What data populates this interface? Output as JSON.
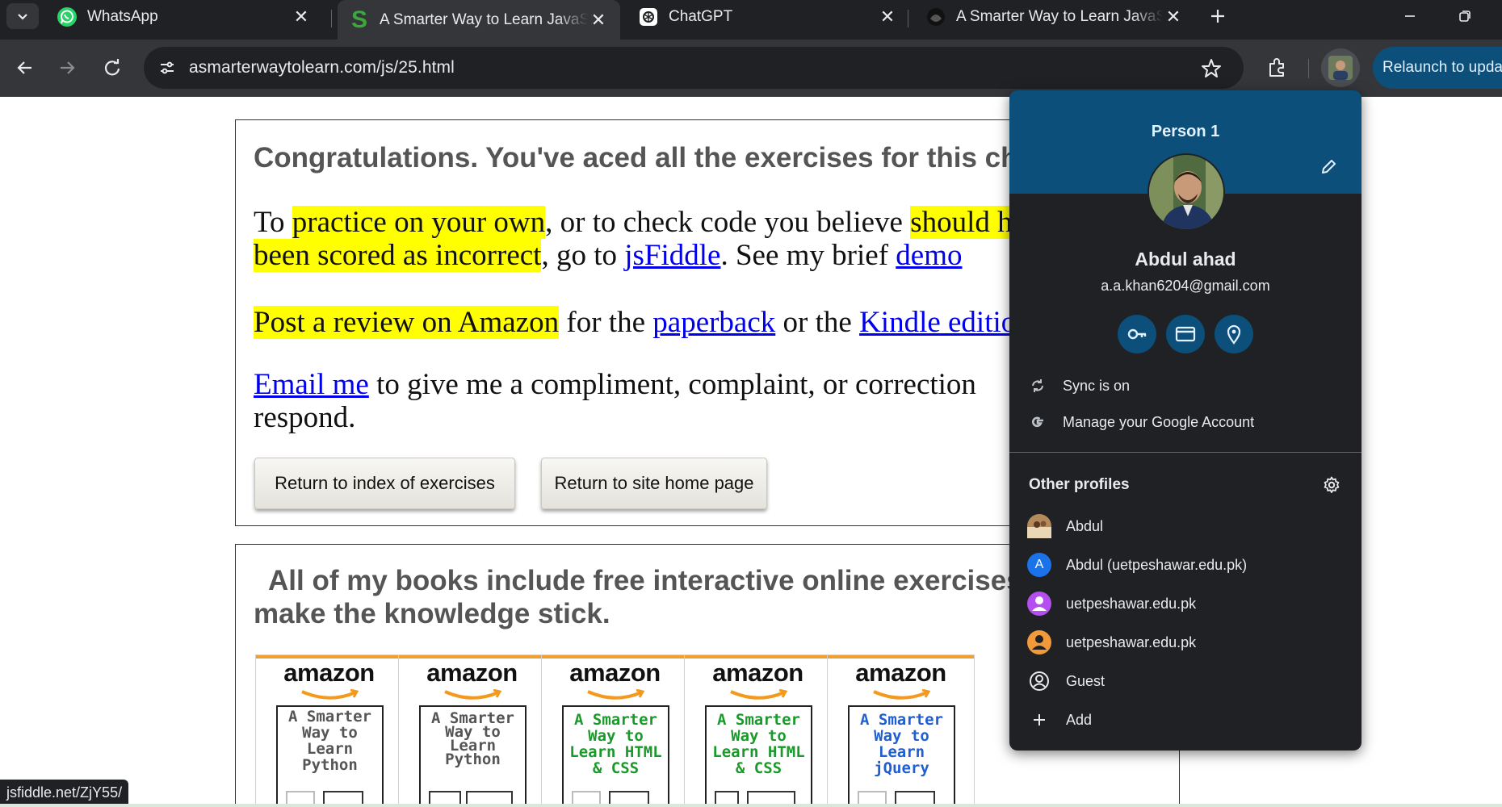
{
  "tabs": [
    {
      "title": "WhatsApp",
      "icon": "whatsapp-icon"
    },
    {
      "title": "A Smarter Way to Learn JavaScript",
      "icon": "smarter-way-s-icon"
    },
    {
      "title": "ChatGPT",
      "icon": "chatgpt-icon"
    },
    {
      "title": "A Smarter Way to Learn JavaScript",
      "icon": "site-logo-icon"
    }
  ],
  "toolbar": {
    "url": "asmarterwaytolearn.com/js/25.html",
    "relaunch_label": "Relaunch to update"
  },
  "page": {
    "headline": "Congratulations. You've aced all the exercises for this chapter.",
    "p1": {
      "a": "To ",
      "b": "practice on your own",
      "c": ", or to check code you believe ",
      "d": "should have",
      "e": "been scored as incorrect",
      "f": ", go to ",
      "g": "jsFiddle",
      "h": ". See my brief ",
      "i": "demo"
    },
    "p2": {
      "a": "Post a review on Amazon",
      "b": " for the ",
      "c": "paperback",
      "d": " or the ",
      "e": "Kindle edition"
    },
    "p3": {
      "a": "Email me",
      "b": " to give me a compliment, complaint, or correction",
      "c": "respond."
    },
    "buttons": {
      "return_index": "Return to index of exercises",
      "return_home": "Return to site home page"
    },
    "books_headline_1": "All of my books include free interactive online exercises that",
    "books_headline_2": "make the knowledge stick.",
    "books": [
      {
        "brand": "amazon",
        "title": "A Smarter Way to Learn Python",
        "color": "#555555"
      },
      {
        "brand": "amazon",
        "title": "A Smarter Way to Learn Python",
        "color": "#555555"
      },
      {
        "brand": "amazon",
        "title": "A Smarter Way to Learn HTML & CSS",
        "color": "#1a9a2a"
      },
      {
        "brand": "amazon",
        "title": "A Smarter Way to Learn HTML & CSS",
        "color": "#1a9a2a"
      },
      {
        "brand": "amazon",
        "title": "A Smarter Way to Learn jQuery",
        "color": "#1f5fd0"
      }
    ]
  },
  "status_url": "jsfiddle.net/ZjY55/",
  "profile": {
    "header": "Person 1",
    "name": "Abdul ahad",
    "email": "a.a.khan6204@gmail.com",
    "sync": "Sync is on",
    "manage": "Manage your Google Account",
    "other_profiles": "Other profiles",
    "others": [
      {
        "label": "Abdul"
      },
      {
        "label": "Abdul (uetpeshawar.edu.pk)",
        "initial": "A"
      },
      {
        "label": "uetpeshawar.edu.pk"
      },
      {
        "label": "uetpeshawar.edu.pk"
      },
      {
        "label": "Guest"
      },
      {
        "label": "Add"
      }
    ]
  }
}
